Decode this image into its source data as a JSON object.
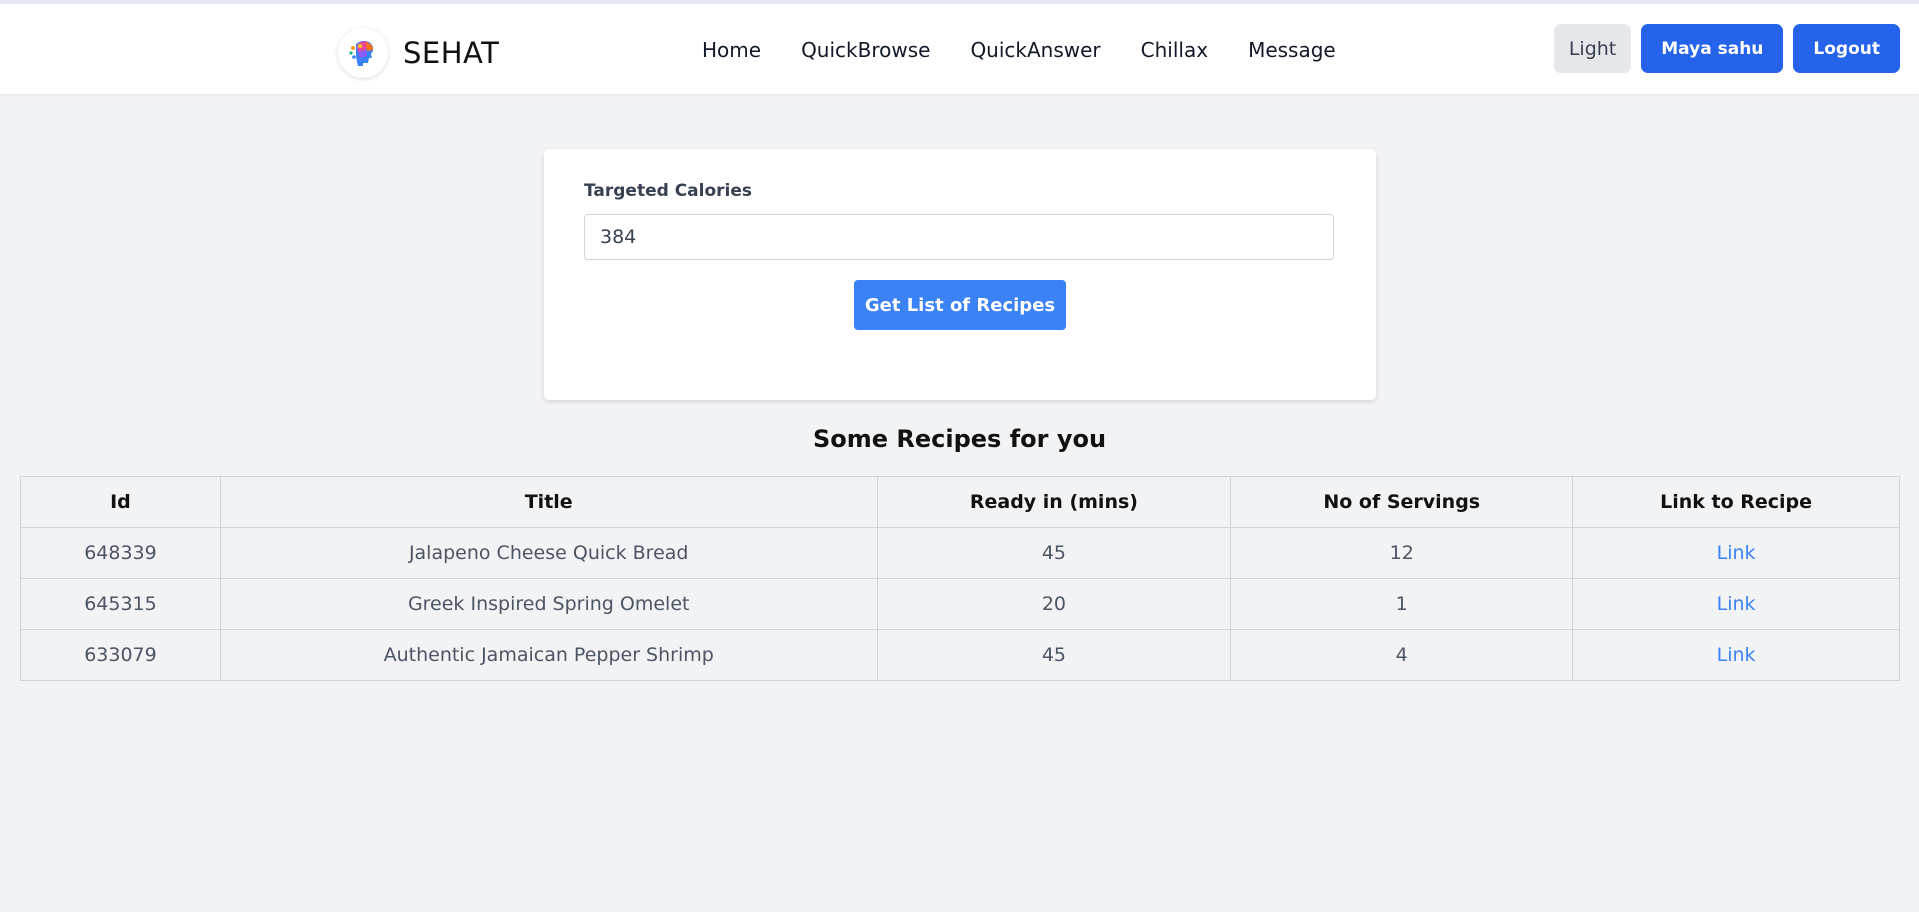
{
  "navbar": {
    "brand": "SEHAT",
    "links": [
      {
        "label": "Home"
      },
      {
        "label": "QuickBrowse"
      },
      {
        "label": "QuickAnswer"
      },
      {
        "label": "Chillax"
      },
      {
        "label": "Message"
      }
    ],
    "theme_toggle": "Light",
    "user_button": "Maya sahu",
    "logout_button": "Logout"
  },
  "form": {
    "label": "Targeted Calories",
    "value": "384",
    "submit_label": "Get List of Recipes"
  },
  "results": {
    "title": "Some Recipes for you",
    "columns": [
      "Id",
      "Title",
      "Ready in (mins)",
      "No of Servings",
      "Link to Recipe"
    ],
    "rows": [
      {
        "id": "648339",
        "title": "Jalapeno Cheese Quick Bread",
        "ready": "45",
        "servings": "12",
        "link": "Link"
      },
      {
        "id": "645315",
        "title": "Greek Inspired Spring Omelet",
        "ready": "20",
        "servings": "1",
        "link": "Link"
      },
      {
        "id": "633079",
        "title": "Authentic Jamaican Pepper Shrimp",
        "ready": "45",
        "servings": "4",
        "link": "Link"
      }
    ]
  },
  "colors": {
    "primary": "#2563eb",
    "button_blue": "#3b82f6",
    "background": "#f2f3f5",
    "link": "#3b82f6"
  },
  "icons": {
    "logo": "colorful-head-logo-icon"
  }
}
